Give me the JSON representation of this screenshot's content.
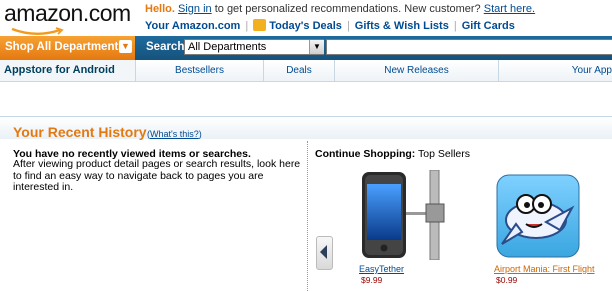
{
  "header": {
    "logo_text": "amazon.com",
    "greeting": "Hello.",
    "signin_link": "Sign in",
    "greeting_rest": " to get personalized recommendations. New customer? ",
    "start_here": "Start here.",
    "links": [
      "Your Amazon.com",
      "Today's Deals",
      "Gifts & Wish Lists",
      "Gift Cards"
    ]
  },
  "navbar": {
    "shop_all": "Shop All Departments",
    "search_label": "Search",
    "department_selected": "All Departments",
    "search_value": ""
  },
  "subnav": {
    "items": [
      "Appstore for Android",
      "Bestsellers",
      "Deals",
      "New Releases",
      "Your App"
    ]
  },
  "recent_history": {
    "title": "Your Recent History",
    "whats_this": "What's this?",
    "empty_heading": "You have no recently viewed items or searches.",
    "empty_body": "After viewing product detail pages or search results, look here to find an easy way to navigate back to pages you are interested in."
  },
  "continue_shopping": {
    "label": "Continue Shopping:",
    "category": "Top Sellers",
    "products": [
      {
        "name": "EasyTether",
        "price": "$9.99"
      },
      {
        "name": "Airport Mania: First Flight",
        "price": "$0.99"
      }
    ]
  },
  "colors": {
    "accent": "#e47911",
    "nav_blue": "#15527c",
    "link": "#004b91"
  }
}
